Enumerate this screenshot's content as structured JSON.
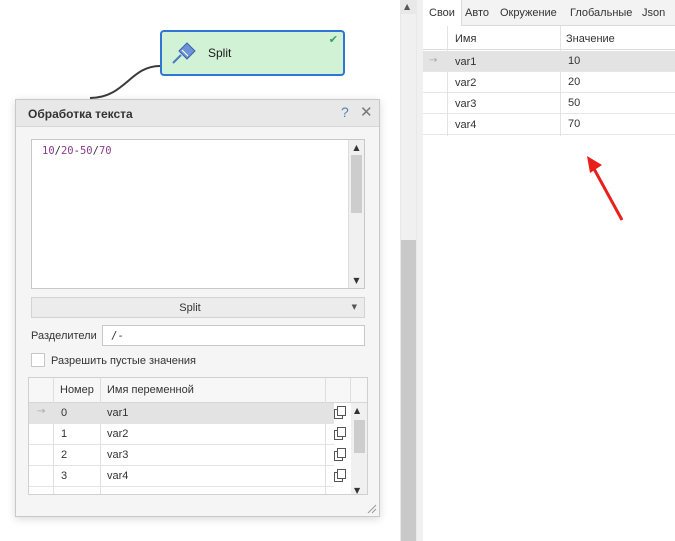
{
  "node": {
    "label": "Split",
    "icon": "pin-icon",
    "status_icon": "check-icon"
  },
  "dialog": {
    "title": "Обработка текста",
    "help_label": "?",
    "close_label": "✕",
    "input_text": {
      "parts": [
        "10",
        "/",
        "20",
        "-",
        "50",
        "/",
        "70"
      ]
    },
    "action": "Split",
    "separators_label": "Разделители",
    "separators_value": "/-",
    "allow_empty_label": "Разрешить пустые значения",
    "allow_empty_checked": false,
    "grid": {
      "columns": [
        "Номер",
        "Имя переменной"
      ],
      "rows": [
        {
          "num": "0",
          "name": "var1"
        },
        {
          "num": "1",
          "name": "var2"
        },
        {
          "num": "2",
          "name": "var3"
        },
        {
          "num": "3",
          "name": "var4"
        }
      ]
    }
  },
  "variables_panel": {
    "tabs": [
      "Свои",
      "Авто",
      "Окружение",
      "Глобальные",
      "Json"
    ],
    "active_tab": "Свои",
    "columns": [
      "Имя",
      "Значение"
    ],
    "rows": [
      {
        "name": "var1",
        "value": "10"
      },
      {
        "name": "var2",
        "value": "20"
      },
      {
        "name": "var3",
        "value": "50"
      },
      {
        "name": "var4",
        "value": "70"
      }
    ]
  },
  "colors": {
    "node_bg": "#d2f2d6",
    "node_border": "#2f75d6",
    "annotation_arrow": "#e8201c"
  }
}
